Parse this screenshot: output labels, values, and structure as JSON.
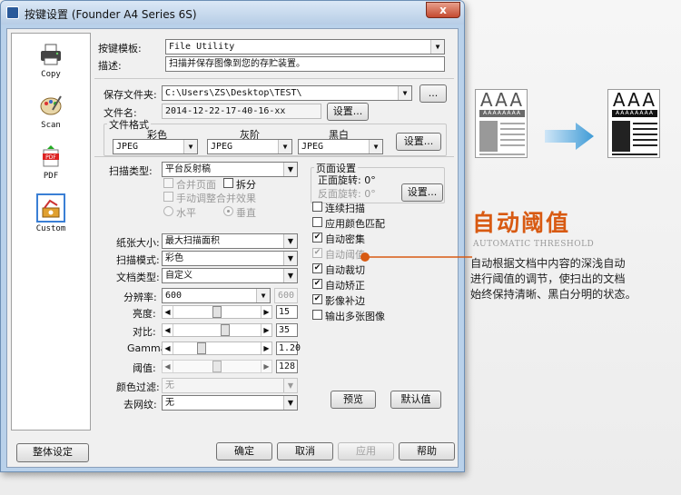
{
  "window": {
    "title": "按键设置 (Founder A4 Series 6S)",
    "close_label": "x"
  },
  "nav": [
    {
      "label": "Copy",
      "icon": "printer-icon"
    },
    {
      "label": "Scan",
      "icon": "palette-icon"
    },
    {
      "label": "PDF",
      "icon": "pdf-icon"
    },
    {
      "label": "Custom",
      "icon": "custom-icon",
      "selected": true
    }
  ],
  "top": {
    "template_label": "按键模板:",
    "template_value": "File Utility",
    "desc_label": "描述:",
    "desc_value": "扫描并保存图像到您的存贮装置。"
  },
  "save": {
    "folder_label": "保存文件夹:",
    "folder_value": "C:\\Users\\ZS\\Desktop\\TEST\\",
    "browse_label": "...",
    "filename_label": "文件名:",
    "filename_value": "2014-12-22-17-40-16-xx",
    "filename_settings": "设置..."
  },
  "format": {
    "group_label": "文件格式",
    "color_label": "彩色",
    "gray_label": "灰阶",
    "bw_label": "黑白",
    "color_value": "JPEG",
    "gray_value": "JPEG",
    "bw_value": "JPEG",
    "settings_label": "设置..."
  },
  "scan": {
    "type_label": "扫描类型:",
    "type_value": "平台反射稿",
    "merge_label": "合并页面",
    "split_label": "拆分",
    "manual_label": "手动调整合并效果",
    "horizontal_label": "水平",
    "vertical_label": "垂直"
  },
  "page": {
    "group_label": "页面设置",
    "front_label": "正面旋转: 0°",
    "back_label": "反面旋转: 0°",
    "settings_label": "设置..."
  },
  "options": [
    {
      "label": "连续扫描",
      "checked": false,
      "disabled": false
    },
    {
      "label": "应用颜色匹配",
      "checked": false,
      "disabled": false
    },
    {
      "label": "自动密集",
      "checked": true,
      "disabled": false
    },
    {
      "label": "自动阈值",
      "checked": true,
      "disabled": true
    },
    {
      "label": "自动裁切",
      "checked": true,
      "disabled": false
    },
    {
      "label": "自动矫正",
      "checked": true,
      "disabled": false
    },
    {
      "label": "影像补边",
      "checked": true,
      "disabled": false
    },
    {
      "label": "输出多张图像",
      "checked": false,
      "disabled": false
    }
  ],
  "settings": {
    "paper_label": "纸张大小:",
    "paper_value": "最大扫描面积",
    "mode_label": "扫描模式:",
    "mode_value": "彩色",
    "doctype_label": "文档类型:",
    "doctype_value": "自定义",
    "dpi_label": "分辨率:",
    "dpi_value": "600",
    "dpi_alt": "600",
    "brightness_label": "亮度:",
    "brightness_value": "15",
    "contrast_label": "对比:",
    "contrast_value": "35",
    "gamma_label": "Gamma:",
    "gamma_value": "1.20",
    "threshold_label": "阈值:",
    "threshold_value": "128",
    "filter_label": "颜色过滤:",
    "filter_value": "无",
    "descreen_label": "去网纹:",
    "descreen_value": "无"
  },
  "sliders": {
    "brightness": 0.5,
    "contrast": 0.6,
    "gamma": 0.3,
    "threshold": 0.5
  },
  "preview_label": "预览",
  "default_label": "默认值",
  "footer": {
    "global_label": "整体设定",
    "ok": "确定",
    "cancel": "取消",
    "apply": "应用",
    "help": "帮助"
  },
  "feature": {
    "title": "自动阈值",
    "subtitle": "AUTOMATIC THRESHOLD",
    "line1": "自动根据文档中内容的深浅自动",
    "line2": "进行阈值的调节，使扫出的文档",
    "line3": "始终保持清晰、黑白分明的状态。",
    "doc_heading": "AAA",
    "doc_bar": "AAAAAAAA"
  },
  "colors": {
    "accent": "#d85a12",
    "arrow": "#3f9bd6"
  }
}
